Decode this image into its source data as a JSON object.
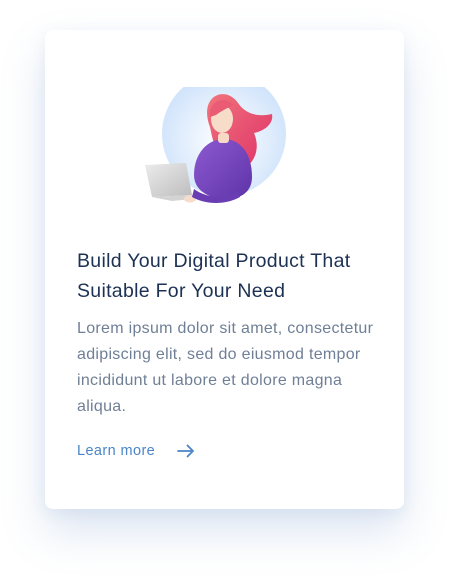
{
  "card": {
    "title": "Build Your Digital Product That Suitable For Your Need",
    "description": "Lorem ipsum dolor sit amet, consectetur adipiscing elit, sed do eiusmod tempor incididunt ut labore et dolore magna aliqua.",
    "link_label": "Learn more",
    "link_icon": "arrow-right-icon",
    "illustration": "woman-with-laptop"
  },
  "colors": {
    "title": "#1c3154",
    "text": "#6f7f96",
    "link": "#4a85c9",
    "hair": "#e9506f",
    "sweater": "#7444b8",
    "circle": "#d6e7fb"
  }
}
